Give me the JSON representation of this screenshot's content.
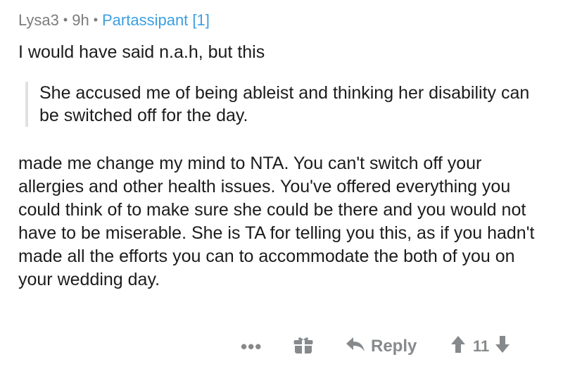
{
  "comment": {
    "author": "Lysa3",
    "age": "9h",
    "flair": "Partassipant [1]",
    "separator": "•",
    "opening": "I would have said n.a.h, but this",
    "quote": "She accused me of being ableist and thinking her disability can be switched off for the day.",
    "body": "made me change my mind to NTA. You can't switch off your allergies and other health issues. You've offered everything you could think of to make sure she could be there and you would not have to be miserable. She is TA for telling you this, as if you hadn't made all the efforts you can to accommodate the both of you on your wedding day."
  },
  "actions": {
    "more_label": "•••",
    "reply_label": "Reply",
    "score": "11"
  },
  "colors": {
    "meta_text": "#7c7c7c",
    "flair": "#3c9fe0",
    "quote_border": "#e1e1e1",
    "action_gray": "#878a8c"
  },
  "icons": {
    "award": "gift-icon",
    "reply": "reply-arrow-icon",
    "upvote": "upvote-arrow-icon",
    "downvote": "downvote-arrow-icon"
  }
}
